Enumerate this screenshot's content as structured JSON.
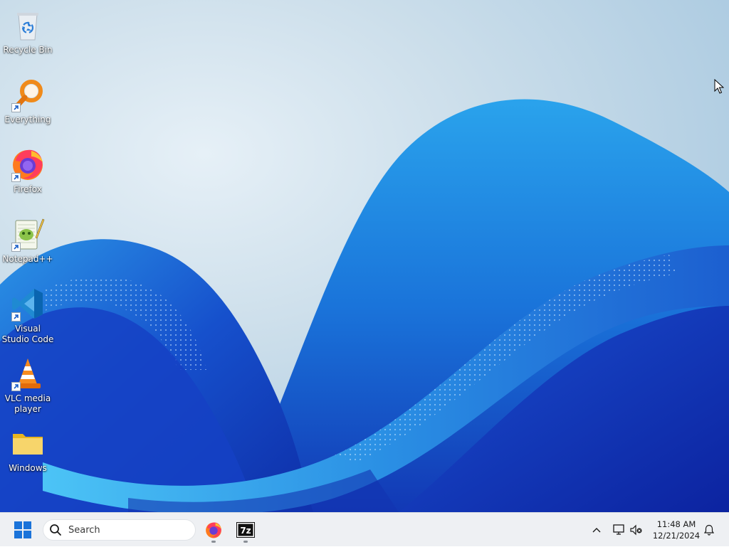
{
  "desktop": {
    "icons": [
      {
        "label": "Recycle Bin",
        "icon": "recycle-bin-icon",
        "shortcut": false
      },
      {
        "label": "Everything",
        "icon": "everything-icon",
        "shortcut": true
      },
      {
        "label": "Firefox",
        "icon": "firefox-icon",
        "shortcut": true
      },
      {
        "label": "Notepad++",
        "icon": "notepadpp-icon",
        "shortcut": true
      },
      {
        "label": "Visual Studio Code",
        "icon": "vscode-icon",
        "shortcut": true
      },
      {
        "label": "VLC media player",
        "icon": "vlc-icon",
        "shortcut": true
      },
      {
        "label": "Windows",
        "icon": "folder-icon",
        "shortcut": false
      }
    ]
  },
  "taskbar": {
    "search_placeholder": "Search",
    "pinned_apps": [
      {
        "name": "Firefox",
        "icon": "firefox-icon",
        "running": true
      },
      {
        "name": "7-Zip",
        "icon": "seven-zip-icon",
        "glyph": "7z",
        "running": true
      }
    ],
    "clock": {
      "time": "11:48 AM",
      "date": "12/21/2024"
    }
  },
  "colors": {
    "taskbar_bg": "#eef0f3",
    "start_blue": "#1a73d9",
    "wallpaper_deep": "#1237b8",
    "wallpaper_light": "#3ba6ea"
  }
}
